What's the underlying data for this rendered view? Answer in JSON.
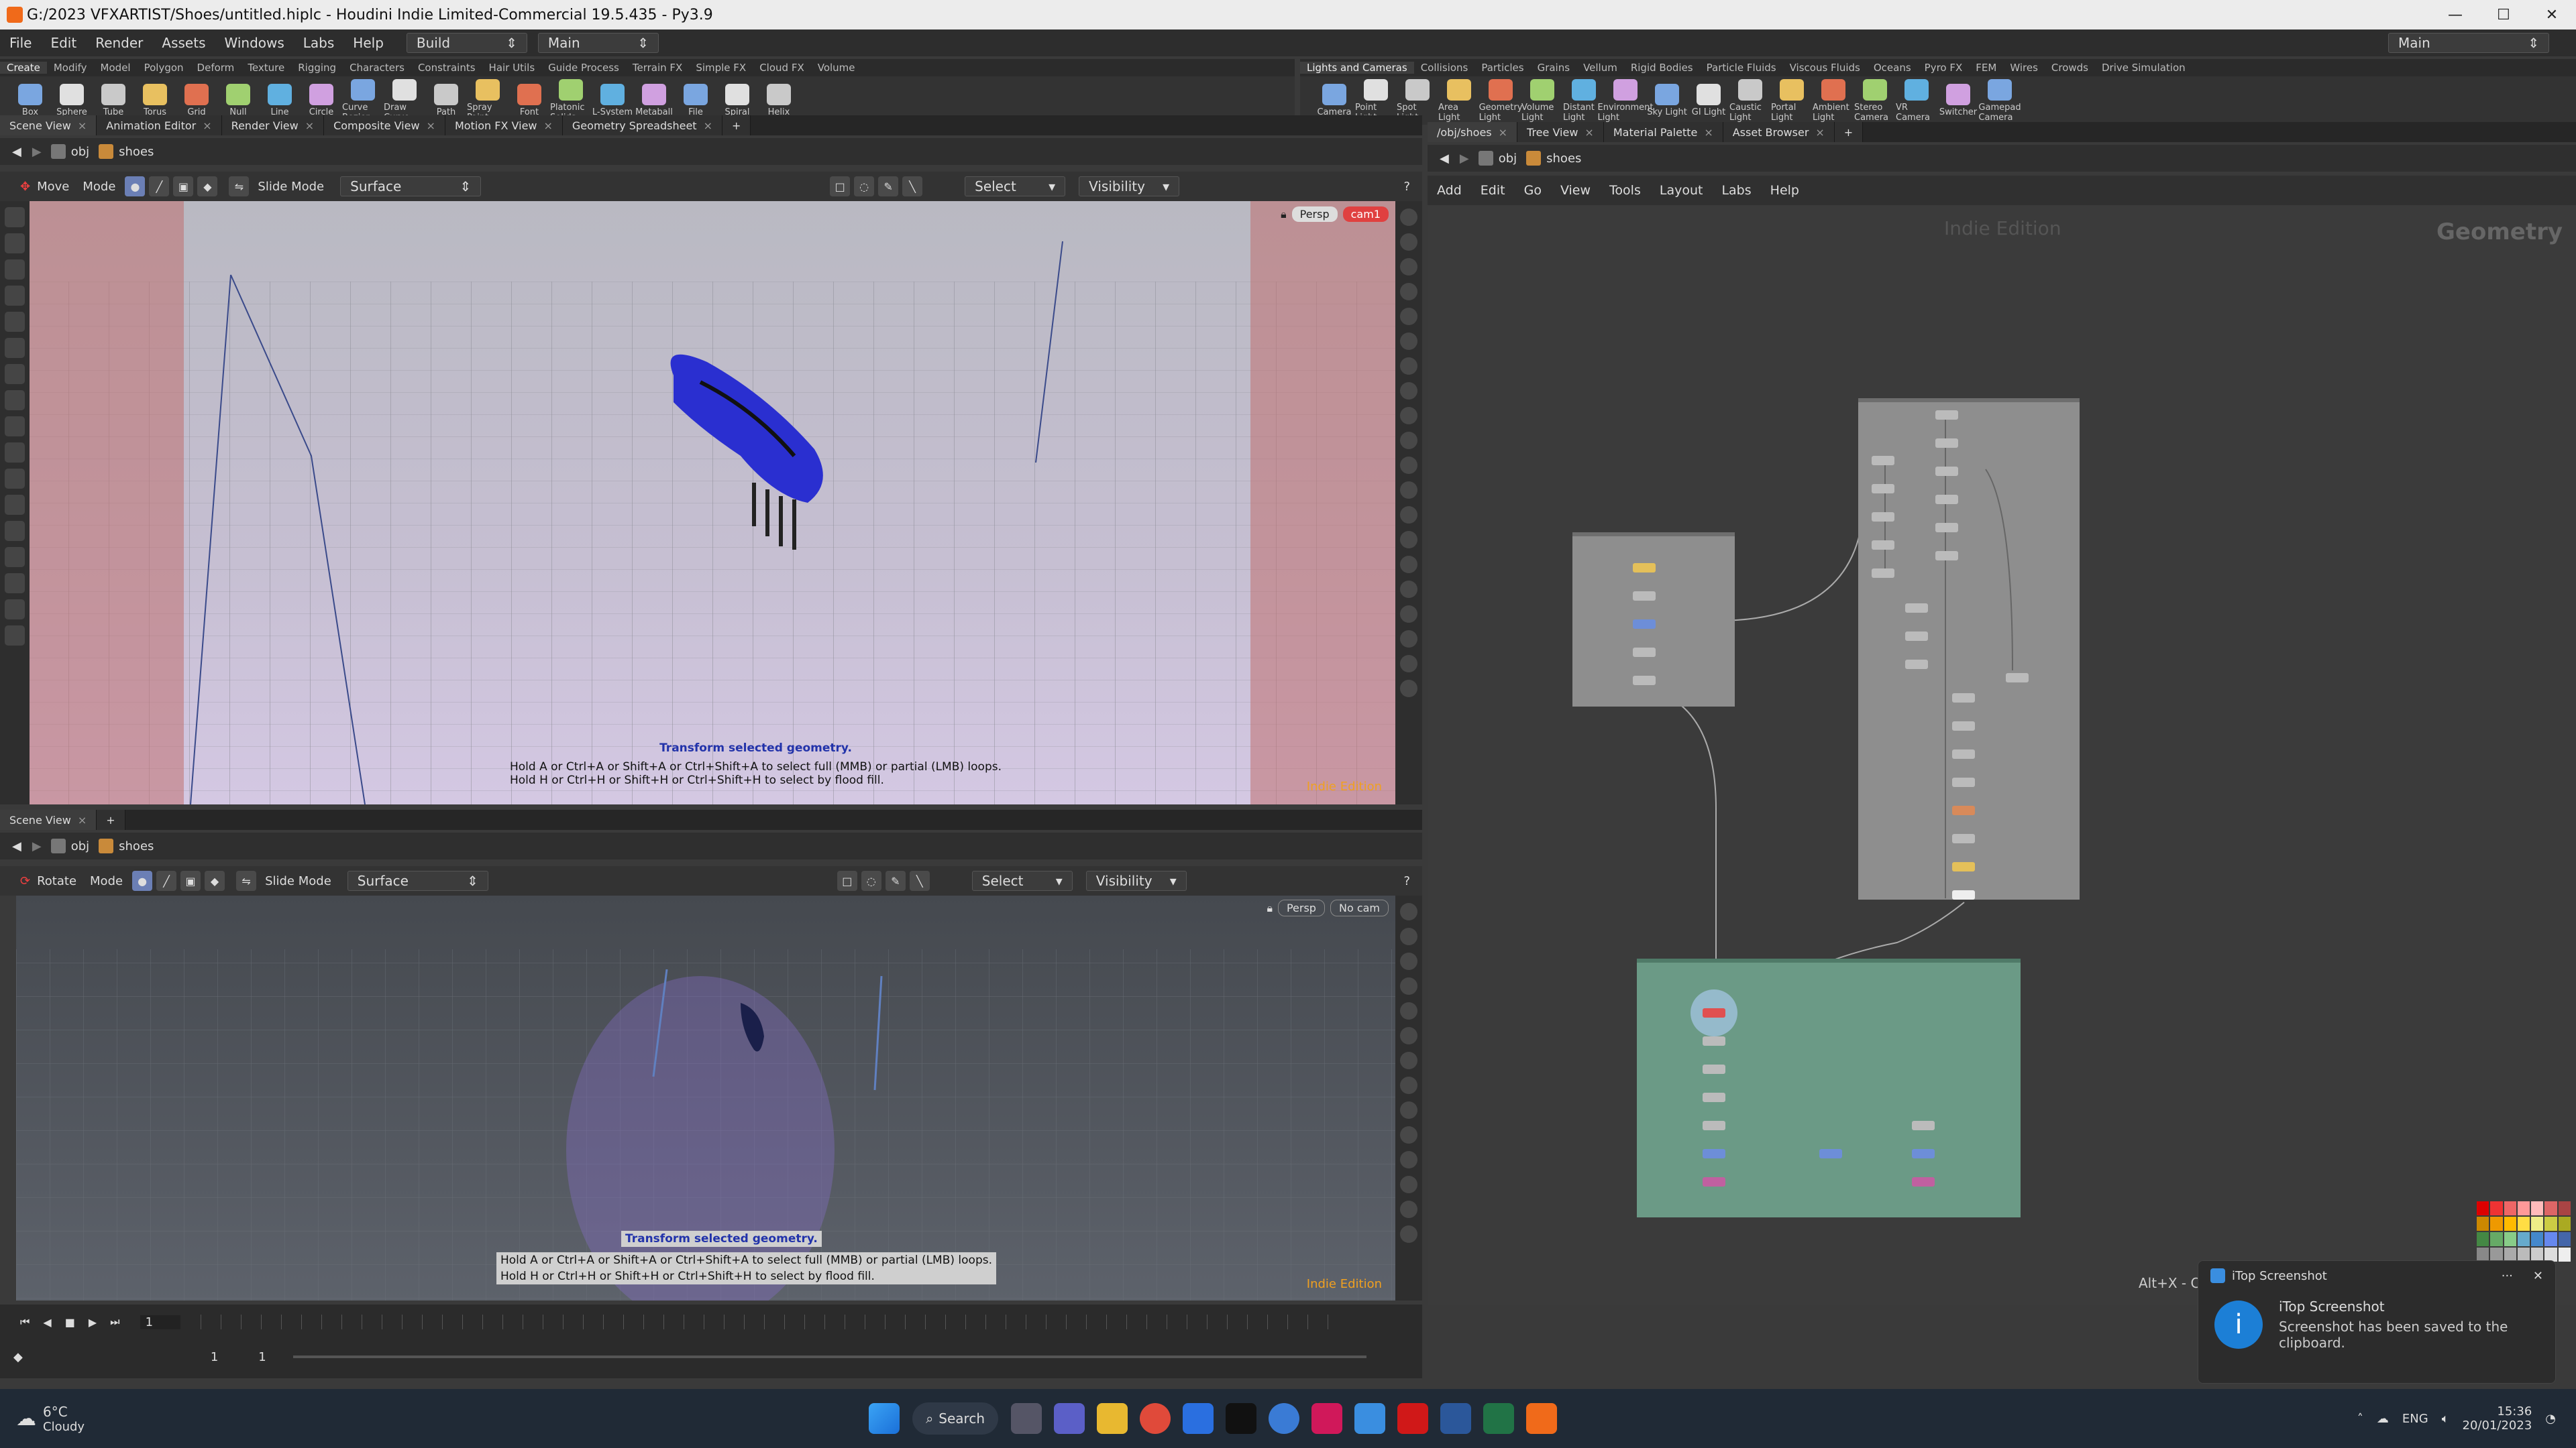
{
  "window": {
    "title": "G:/2023 VFXARTIST/Shoes/untitled.hiplc - Houdini Indie Limited-Commercial 19.5.435 - Py3.9"
  },
  "menu": {
    "items": [
      "File",
      "Edit",
      "Render",
      "Assets",
      "Windows",
      "Labs",
      "Help"
    ],
    "desktop": "Build",
    "context": "Main",
    "right_context": "Main"
  },
  "shelf_left": {
    "tabs": [
      "Create",
      "Modify",
      "Model",
      "Polygon",
      "Deform",
      "Texture",
      "Rigging",
      "Characters",
      "Constraints",
      "Hair Utils",
      "Guide Process",
      "Terrain FX",
      "Simple FX",
      "Cloud FX",
      "Volume"
    ],
    "tools": [
      "Box",
      "Sphere",
      "Tube",
      "Torus",
      "Grid",
      "Null",
      "Line",
      "Circle",
      "Curve Bezier",
      "Draw Curve",
      "Path",
      "Spray Paint",
      "Font",
      "Platonic Solids",
      "L-System",
      "Metaball",
      "File",
      "Spiral",
      "Helix"
    ]
  },
  "shelf_right": {
    "tabs": [
      "Lights and Cameras",
      "Collisions",
      "Particles",
      "Grains",
      "Vellum",
      "Rigid Bodies",
      "Particle Fluids",
      "Viscous Fluids",
      "Oceans",
      "Pyro FX",
      "FEM",
      "Wires",
      "Crowds",
      "Drive Simulation"
    ],
    "tools": [
      "Camera",
      "Point Light",
      "Spot Light",
      "Area Light",
      "Geometry Light",
      "Volume Light",
      "Distant Light",
      "Environment Light",
      "Sky Light",
      "GI Light",
      "Caustic Light",
      "Portal Light",
      "Ambient Light",
      "Stereo Camera",
      "VR Camera",
      "Switcher",
      "Gamepad Camera"
    ]
  },
  "left_panel_tabs": [
    "Scene View",
    "Animation Editor",
    "Render View",
    "Composite View",
    "Motion FX View",
    "Geometry Spreadsheet"
  ],
  "right_panel_tabs": [
    "/obj/shoes",
    "Tree View",
    "Material Palette",
    "Asset Browser"
  ],
  "path": {
    "root": "obj",
    "node": "shoes"
  },
  "viewport_top": {
    "tool": "Move",
    "mode_label": "Mode",
    "slide_mode": "Slide Mode",
    "surface": "Surface",
    "select": "Select",
    "visibility": "Visibility",
    "view": "Persp",
    "camera": "cam1",
    "hint_title": "Transform selected geometry.",
    "hint_line1": "Hold A or Ctrl+A or Shift+A or Ctrl+Shift+A to select full (MMB) or partial (LMB) loops.",
    "hint_line2": "Hold H or Ctrl+H or Shift+H or Ctrl+Shift+H to select by flood fill.",
    "watermark": "Indie Edition"
  },
  "viewport_bottom": {
    "panel_tab": "Scene View",
    "tool": "Rotate",
    "mode_label": "Mode",
    "slide_mode": "Slide Mode",
    "surface": "Surface",
    "select": "Select",
    "visibility": "Visibility",
    "view": "Persp",
    "camera": "No cam",
    "hint_title": "Transform selected geometry.",
    "hint_line1": "Hold A or Ctrl+A or Shift+A or Ctrl+Shift+A to select full (MMB) or partial (LMB) loops.",
    "hint_line2": "Hold H or Ctrl+H or Shift+H or Ctrl+Shift+H to select by flood fill.",
    "watermark": "Indie Edition"
  },
  "network": {
    "menu": [
      "Add",
      "Edit",
      "Go",
      "View",
      "Tools",
      "Layout",
      "Labs",
      "Help"
    ],
    "watermark": "Indie Edition",
    "context_label": "Geometry",
    "status": "Alt+X - Cut"
  },
  "timeline": {
    "frame": "1",
    "start": "1",
    "end": "1"
  },
  "toast": {
    "app": "iTop Screenshot",
    "title": "iTop Screenshot",
    "message": "Screenshot has been saved to the clipboard."
  },
  "taskbar": {
    "temp": "6°C",
    "weather": "Cloudy",
    "search": "Search",
    "lang": "ENG",
    "time": "15:36",
    "date": "20/01/2023"
  },
  "colors": {
    "accent": "#f0a020",
    "shoe": "#2a2fd0",
    "network_green": "#6b9a86",
    "network_grey": "#8e8e8e"
  }
}
